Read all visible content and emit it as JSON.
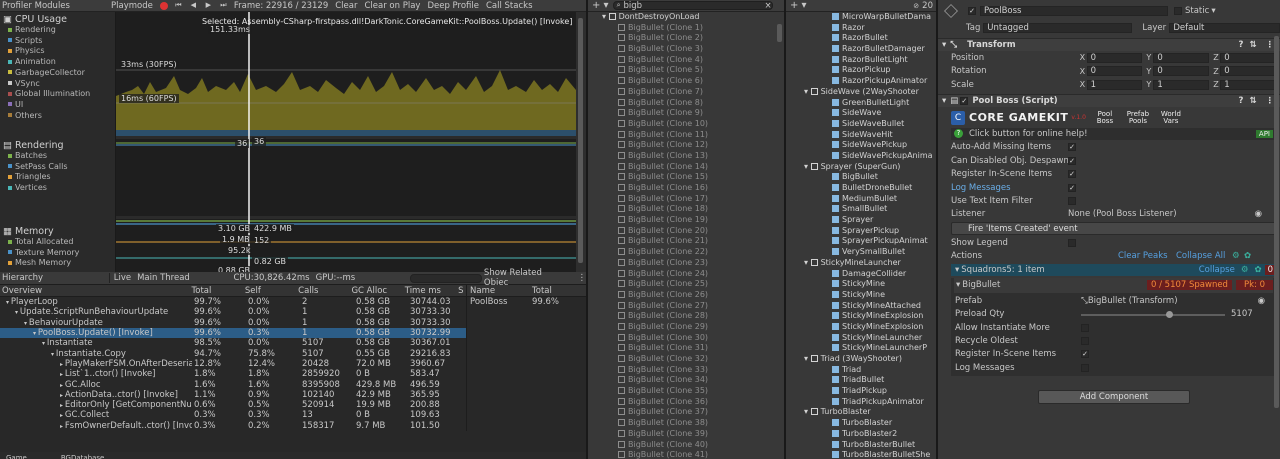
{
  "profiler": {
    "toolbar": {
      "modules_label": "Profiler Modules",
      "playmode": "Playmode",
      "frame": "Frame: 22916 / 23129",
      "clear": "Clear",
      "clear_on_play": "Clear on Play",
      "deep_profile": "Deep Profile",
      "call_stacks": "Call Stacks"
    },
    "selected_text": "Selected: Assembly-CSharp-firstpass.dll!DarkTonic.CoreGameKit::PoolBoss.Update() [Invoke]",
    "cpu": {
      "title": "CPU Usage",
      "items": [
        {
          "label": "Rendering",
          "color": "#7db24c"
        },
        {
          "label": "Scripts",
          "color": "#4a92c8"
        },
        {
          "label": "Physics",
          "color": "#e2a13a"
        },
        {
          "label": "Animation",
          "color": "#4ab7b7"
        },
        {
          "label": "GarbageCollector",
          "color": "#c9bd3f"
        },
        {
          "label": "VSync",
          "color": "#c9c9c9"
        },
        {
          "label": "Global Illumination",
          "color": "#a84e4e"
        },
        {
          "label": "UI",
          "color": "#8a6fb8"
        },
        {
          "label": "Others",
          "color": "#a67c3a"
        }
      ],
      "label_top": "151.33ms",
      "label_30": "33ms (30FPS)",
      "label_60": "16ms (60FPS)"
    },
    "rendering": {
      "title": "Rendering",
      "items": [
        {
          "label": "Batches",
          "color": "#7db24c"
        },
        {
          "label": "SetPass Calls",
          "color": "#4a92c8"
        },
        {
          "label": "Triangles",
          "color": "#e2a13a"
        },
        {
          "label": "Vertices",
          "color": "#4ab7b7"
        }
      ],
      "label_a": "36",
      "label_b": "36"
    },
    "memory": {
      "title": "Memory",
      "items": [
        {
          "label": "Total Allocated",
          "color": "#7db24c"
        },
        {
          "label": "Texture Memory",
          "color": "#4a92c8"
        },
        {
          "label": "Mesh Memory",
          "color": "#e2a13a"
        }
      ],
      "labels": [
        "3.10 GB",
        "422.9 MB",
        "1.9 MB",
        "152",
        "95.2k",
        "0.82 GB",
        "0.88 GB"
      ]
    },
    "hierarchy": {
      "view": "Hierarchy",
      "live": "Live",
      "thread": "Main Thread",
      "cpu_time": "CPU:30,826.42ms",
      "gpu_time": "GPU:--ms",
      "related": "Show Related Objec",
      "columns": [
        "Overview",
        "Total",
        "Self",
        "Calls",
        "GC Alloc",
        "Time ms",
        "S"
      ],
      "rows": [
        {
          "name": "PlayerLoop",
          "indent": 0,
          "total": "99.7%",
          "self": "0.0%",
          "calls": "2",
          "gc": "0.58 GB",
          "time": "30744.03",
          "sel": false
        },
        {
          "name": "Update.ScriptRunBehaviourUpdate",
          "indent": 1,
          "total": "99.6%",
          "self": "0.0%",
          "calls": "1",
          "gc": "0.58 GB",
          "time": "30733.30",
          "sel": false
        },
        {
          "name": "BehaviourUpdate",
          "indent": 2,
          "total": "99.6%",
          "self": "0.0%",
          "calls": "1",
          "gc": "0.58 GB",
          "time": "30733.30",
          "sel": false
        },
        {
          "name": "PoolBoss.Update() [Invoke]",
          "indent": 3,
          "total": "99.6%",
          "self": "0.3%",
          "calls": "1",
          "gc": "0.58 GB",
          "time": "30732.99",
          "sel": true
        },
        {
          "name": "Instantiate",
          "indent": 4,
          "total": "98.5%",
          "self": "0.0%",
          "calls": "5107",
          "gc": "0.58 GB",
          "time": "30367.01",
          "sel": false
        },
        {
          "name": "Instantiate.Copy",
          "indent": 5,
          "total": "94.7%",
          "self": "75.8%",
          "calls": "5107",
          "gc": "0.55 GB",
          "time": "29216.83",
          "sel": false
        },
        {
          "name": "PlayMakerFSM.OnAfterDeserializ",
          "indent": 6,
          "total": "12.8%",
          "self": "12.4%",
          "calls": "20428",
          "gc": "72.0 MB",
          "time": "3960.67",
          "sel": false
        },
        {
          "name": "List`1..ctor() [Invoke]",
          "indent": 6,
          "total": "1.8%",
          "self": "1.8%",
          "calls": "2859920",
          "gc": "0 B",
          "time": "583.47",
          "sel": false
        },
        {
          "name": "GC.Alloc",
          "indent": 6,
          "total": "1.6%",
          "self": "1.6%",
          "calls": "8395908",
          "gc": "429.8 MB",
          "time": "496.59",
          "sel": false
        },
        {
          "name": "ActionData..ctor() [Invoke]",
          "indent": 6,
          "total": "1.1%",
          "self": "0.9%",
          "calls": "102140",
          "gc": "42.9 MB",
          "time": "365.95",
          "sel": false
        },
        {
          "name": "EditorOnly [GetComponentNullErr",
          "indent": 6,
          "total": "0.6%",
          "self": "0.5%",
          "calls": "520914",
          "gc": "19.9 MB",
          "time": "200.88",
          "sel": false
        },
        {
          "name": "GC.Collect",
          "indent": 6,
          "total": "0.3%",
          "self": "0.3%",
          "calls": "13",
          "gc": "0 B",
          "time": "109.63",
          "sel": false
        },
        {
          "name": "FsmOwnerDefault..ctor() [Invoke]",
          "indent": 6,
          "total": "0.3%",
          "self": "0.2%",
          "calls": "158317",
          "gc": "9.7 MB",
          "time": "101.50",
          "sel": false
        }
      ],
      "related_cols": [
        "Name",
        "Total"
      ],
      "related_rows": [
        {
          "name": "PoolBoss",
          "total": "99.6%"
        }
      ]
    },
    "bottom_tabs": [
      "Game",
      "BGDatabase"
    ]
  },
  "scene": {
    "search_value": "bigb",
    "root": "DontDestroyOnLoad",
    "items": [
      "BigBullet (Clone 1)",
      "BigBullet (Clone 2)",
      "BigBullet (Clone 3)",
      "BigBullet (Clone 4)",
      "BigBullet (Clone 5)",
      "BigBullet (Clone 6)",
      "BigBullet (Clone 7)",
      "BigBullet (Clone 8)",
      "BigBullet (Clone 9)",
      "BigBullet (Clone 10)",
      "BigBullet (Clone 11)",
      "BigBullet (Clone 12)",
      "BigBullet (Clone 13)",
      "BigBullet (Clone 14)",
      "BigBullet (Clone 15)",
      "BigBullet (Clone 16)",
      "BigBullet (Clone 17)",
      "BigBullet (Clone 18)",
      "BigBullet (Clone 19)",
      "BigBullet (Clone 20)",
      "BigBullet (Clone 21)",
      "BigBullet (Clone 22)",
      "BigBullet (Clone 23)",
      "BigBullet (Clone 24)",
      "BigBullet (Clone 25)",
      "BigBullet (Clone 26)",
      "BigBullet (Clone 27)",
      "BigBullet (Clone 28)",
      "BigBullet (Clone 29)",
      "BigBullet (Clone 30)",
      "BigBullet (Clone 31)",
      "BigBullet (Clone 32)",
      "BigBullet (Clone 33)",
      "BigBullet (Clone 34)",
      "BigBullet (Clone 35)",
      "BigBullet (Clone 36)",
      "BigBullet (Clone 37)",
      "BigBullet (Clone 38)",
      "BigBullet (Clone 39)",
      "BigBullet (Clone 40)",
      "BigBullet (Clone 41)"
    ]
  },
  "scene2": {
    "hidden_count": "20",
    "items": [
      {
        "t": "MicroWarpBulletDama",
        "d": 1,
        "g": false
      },
      {
        "t": "Razor",
        "d": 1,
        "g": false
      },
      {
        "t": "RazorBullet",
        "d": 1,
        "g": false
      },
      {
        "t": "RazorBulletDamager",
        "d": 1,
        "g": false
      },
      {
        "t": "RazorBulletLight",
        "d": 1,
        "g": false
      },
      {
        "t": "RazorPickup",
        "d": 1,
        "g": false
      },
      {
        "t": "RazorPickupAnimator",
        "d": 1,
        "g": false
      },
      {
        "t": "SideWave (2WayShooter",
        "d": 0,
        "g": true
      },
      {
        "t": "GreenBulletLight",
        "d": 1,
        "g": false
      },
      {
        "t": "SideWave",
        "d": 1,
        "g": false
      },
      {
        "t": "SideWaveBullet",
        "d": 1,
        "g": false
      },
      {
        "t": "SideWaveHit",
        "d": 1,
        "g": false
      },
      {
        "t": "SideWavePickup",
        "d": 1,
        "g": false
      },
      {
        "t": "SideWavePickupAnima",
        "d": 1,
        "g": false
      },
      {
        "t": "Sprayer (SuperGun)",
        "d": 0,
        "g": true
      },
      {
        "t": "BigBullet",
        "d": 1,
        "g": false
      },
      {
        "t": "BulletDroneBullet",
        "d": 1,
        "g": false
      },
      {
        "t": "MediumBullet",
        "d": 1,
        "g": false
      },
      {
        "t": "SmallBullet",
        "d": 1,
        "g": false
      },
      {
        "t": "Sprayer",
        "d": 1,
        "g": false
      },
      {
        "t": "SprayerPickup",
        "d": 1,
        "g": false
      },
      {
        "t": "SprayerPickupAnimat",
        "d": 1,
        "g": false
      },
      {
        "t": "VerySmallBullet",
        "d": 1,
        "g": false
      },
      {
        "t": "StickyMineLauncher",
        "d": 0,
        "g": true
      },
      {
        "t": "DamageCollider",
        "d": 1,
        "g": false
      },
      {
        "t": "StickyMine",
        "d": 1,
        "g": false
      },
      {
        "t": "StickyMine",
        "d": 1,
        "g": false
      },
      {
        "t": "StickyMineAttached",
        "d": 1,
        "g": false
      },
      {
        "t": "StickyMineExplosion",
        "d": 1,
        "g": false
      },
      {
        "t": "StickyMineExplosion",
        "d": 1,
        "g": false
      },
      {
        "t": "StickyMineLauncher",
        "d": 1,
        "g": false
      },
      {
        "t": "StickyMineLauncherP",
        "d": 1,
        "g": false
      },
      {
        "t": "Triad (3WayShooter)",
        "d": 0,
        "g": true
      },
      {
        "t": "Triad",
        "d": 1,
        "g": false
      },
      {
        "t": "TriadBullet",
        "d": 1,
        "g": false
      },
      {
        "t": "TriadPickup",
        "d": 1,
        "g": false
      },
      {
        "t": "TriadPickupAnimator",
        "d": 1,
        "g": false
      },
      {
        "t": "TurboBlaster",
        "d": 0,
        "g": true
      },
      {
        "t": "TurboBlaster",
        "d": 1,
        "g": false
      },
      {
        "t": "TurboBlaster2",
        "d": 1,
        "g": false
      },
      {
        "t": "TurboBlasterBullet",
        "d": 1,
        "g": false
      },
      {
        "t": "TurboBlasterBulletShe",
        "d": 1,
        "g": false
      }
    ]
  },
  "inspector": {
    "object_name": "PoolBoss",
    "static_label": "Static",
    "tag_label": "Tag",
    "tag_value": "Untagged",
    "layer_label": "Layer",
    "layer_value": "Default",
    "transform": {
      "title": "Transform",
      "rows": [
        {
          "label": "Position",
          "x": "0",
          "y": "0",
          "z": "0"
        },
        {
          "label": "Rotation",
          "x": "0",
          "y": "0",
          "z": "0"
        },
        {
          "label": "Scale",
          "x": "1",
          "y": "1",
          "z": "1"
        }
      ]
    },
    "poolboss": {
      "title": "Pool Boss (Script)",
      "banner_brand": "CORE GAMEKIT",
      "banner_version": "v.1.0",
      "banner_links": [
        "Pool Boss",
        "Prefab Pools",
        "World Vars"
      ],
      "help_text": "Click button for online help!",
      "api_label": "API",
      "settings": [
        {
          "label": "Auto-Add Missing Items",
          "checked": true,
          "link": false
        },
        {
          "label": "Can Disabled Obj. Despawn",
          "checked": true,
          "link": false
        },
        {
          "label": "Register In-Scene Items",
          "checked": true,
          "link": false
        },
        {
          "label": "Log Messages",
          "checked": true,
          "link": true
        },
        {
          "label": "Use Text Item Filter",
          "checked": false,
          "link": false
        }
      ],
      "listener_label": "Listener",
      "listener_value": "None (Pool Boss Listener)",
      "fire_event": "Fire 'Items Created' event",
      "show_legend": "Show Legend",
      "actions_label": "Actions",
      "clear_peaks": "Clear Peaks",
      "collapse_all": "Collapse All",
      "category": "Squadrons5: 1 item",
      "collapse": "Collapse",
      "category_count": "0",
      "item_name": "BigBullet",
      "spawned": "0 / 5107 Spawned",
      "peak": "Pk: 0",
      "prefab_label": "Prefab",
      "prefab_value": "BigBullet (Transform)",
      "preload_label": "Preload Qty",
      "preload_value": "5107",
      "preload_fraction": 0.62,
      "item_settings": [
        {
          "label": "Allow Instantiate More",
          "checked": false
        },
        {
          "label": "Recycle Oldest",
          "checked": false
        },
        {
          "label": "Register In-Scene Items",
          "checked": true
        },
        {
          "label": "Log Messages",
          "checked": false
        }
      ]
    },
    "add_component": "Add Component"
  }
}
